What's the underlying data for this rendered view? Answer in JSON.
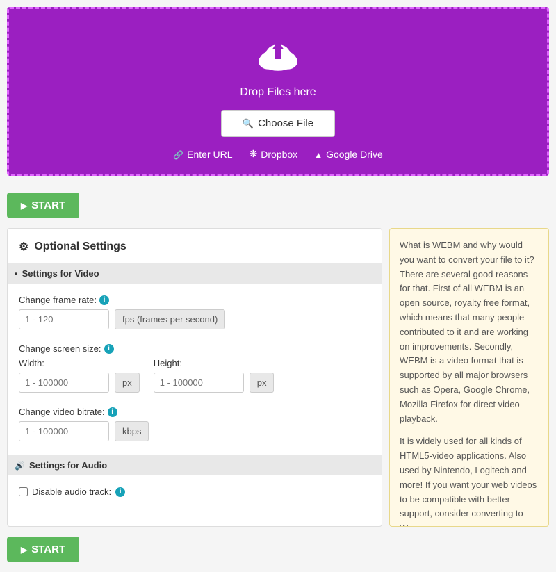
{
  "upload": {
    "drop_text": "Drop Files here",
    "choose_file_label": "Choose File",
    "enter_url_label": "Enter URL",
    "dropbox_label": "Dropbox",
    "google_drive_label": "Google Drive"
  },
  "start_button": {
    "label": "START"
  },
  "settings": {
    "title": "Optional Settings",
    "video_section": {
      "header": "Settings for Video",
      "frame_rate": {
        "label": "Change frame rate:",
        "placeholder": "1 - 120",
        "unit": "fps (frames per second)"
      },
      "screen_size": {
        "label": "Change screen size:",
        "width_label": "Width:",
        "width_placeholder": "1 - 100000",
        "width_unit": "px",
        "height_label": "Height:",
        "height_placeholder": "1 - 100000",
        "height_unit": "px"
      },
      "bitrate": {
        "label": "Change video bitrate:",
        "placeholder": "1 - 100000",
        "unit": "kbps"
      }
    },
    "audio_section": {
      "header": "Settings for Audio",
      "disable_audio_label": "Disable audio track:"
    }
  },
  "info_panel": {
    "paragraph1": "What is WEBM and why would you want to convert your file to it? There are several good reasons for that. First of all WEBM is an open source, royalty free format, which means that many people contributed to it and are working on improvements. Secondly, WEBM is a video format that is supported by all major browsers such as Opera, Google Chrome, Mozilla Firefox for direct video playback.",
    "paragraph2": "It is widely used for all kinds of HTML5-video applications. Also used by Nintendo, Logitech and more! If you want your web videos to be compatible with better support, consider converting to W..."
  }
}
